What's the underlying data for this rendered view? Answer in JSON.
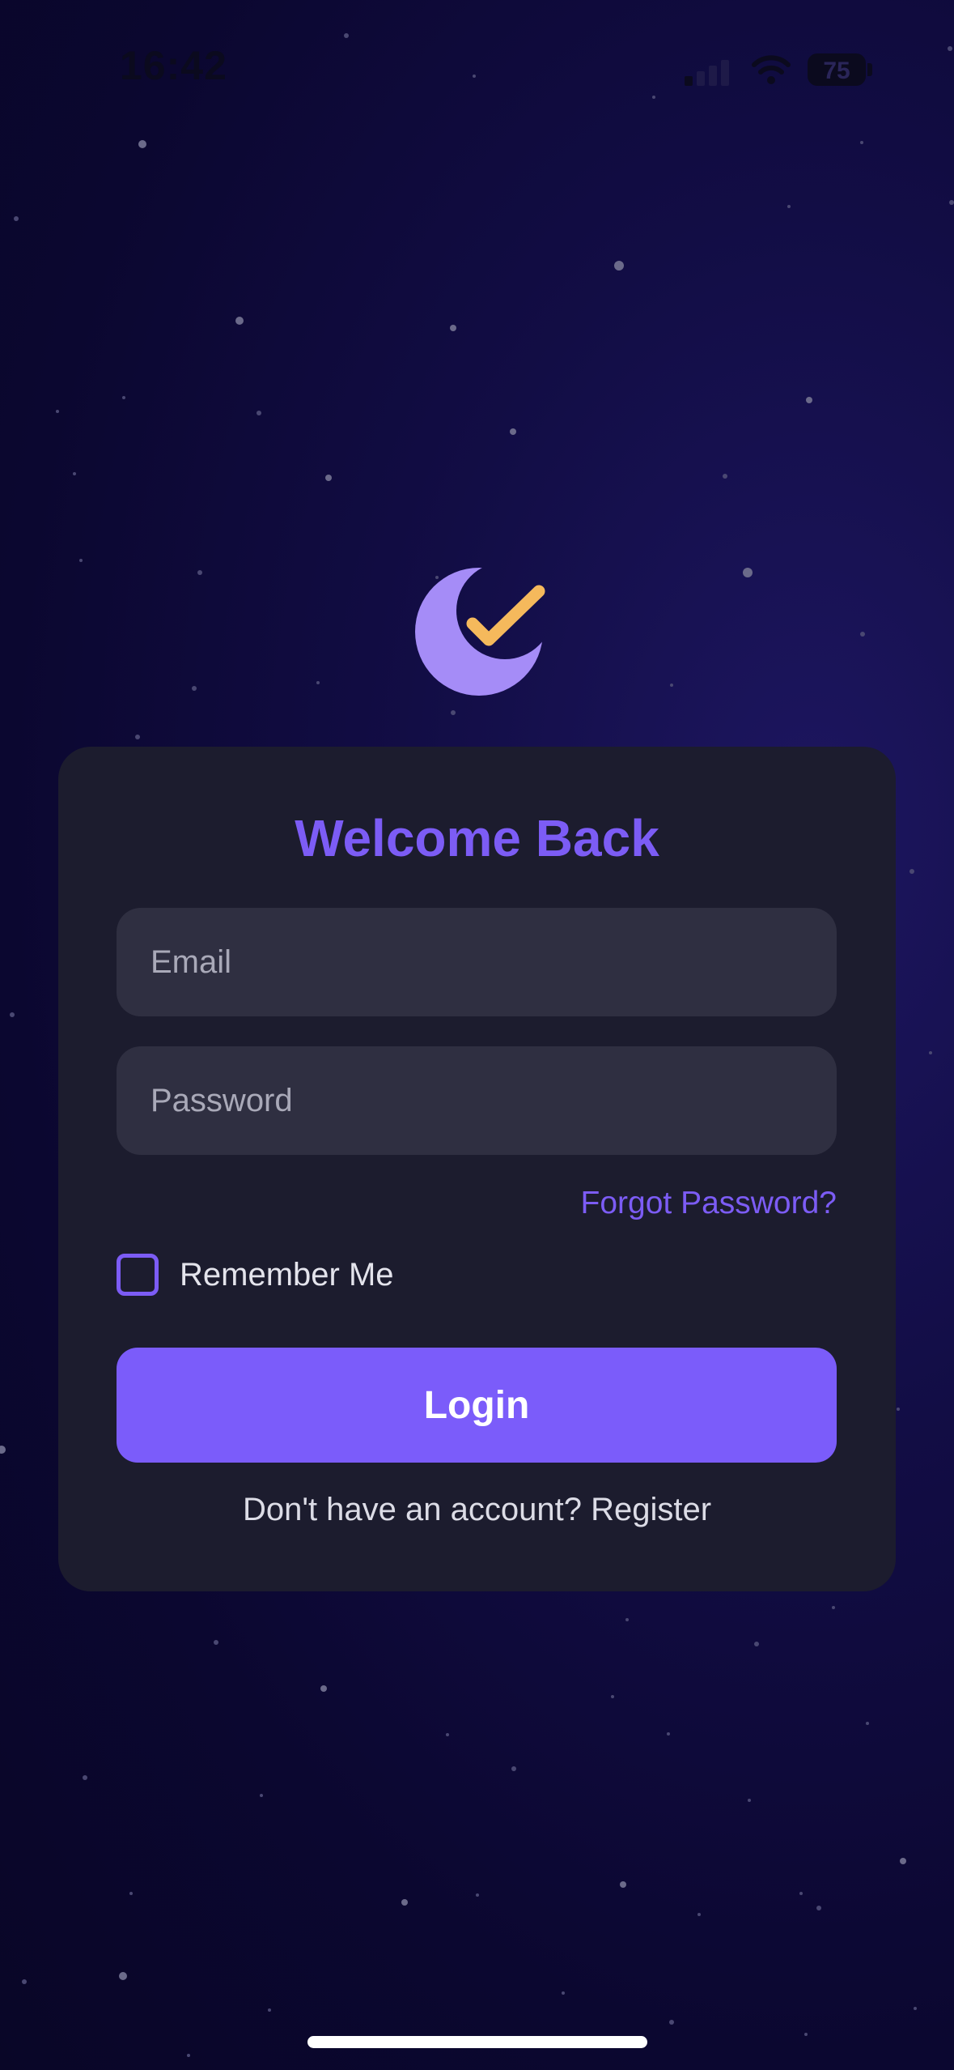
{
  "status_bar": {
    "time": "16:42",
    "battery_level": "75",
    "icons": [
      "signal-icon",
      "wifi-icon",
      "battery-icon"
    ]
  },
  "logo": {
    "icon": "moon-check-icon",
    "colors": {
      "moon": "#a58cf7",
      "check": "#f5b95c"
    }
  },
  "login": {
    "title": "Welcome Back",
    "email_placeholder": "Email",
    "password_placeholder": "Password",
    "forgot_password": "Forgot Password?",
    "remember_me": "Remember Me",
    "login_button": "Login",
    "register_prompt": "Don't have an account? Register"
  },
  "colors": {
    "accent": "#7c5cf5",
    "card_background": "#1c1c2e",
    "field_background": "#2f2f41"
  }
}
